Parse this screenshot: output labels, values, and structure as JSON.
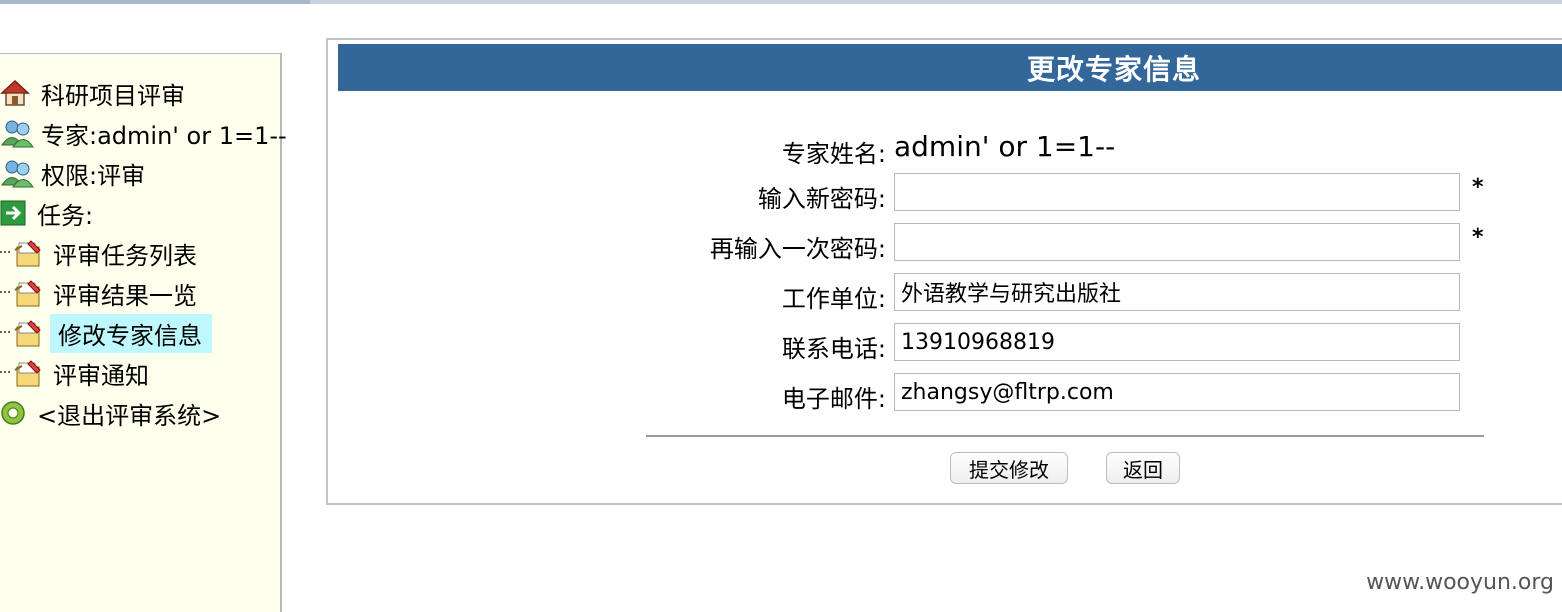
{
  "sidebar": {
    "items": [
      {
        "label": "科研项目评审",
        "icon": "home-icon"
      },
      {
        "label": "专家:admin' or 1=1--",
        "icon": "users-icon"
      },
      {
        "label": "权限:评审",
        "icon": "users-icon"
      },
      {
        "label": "任务:",
        "icon": "arrow-right-icon"
      },
      {
        "label": "评审任务列表",
        "icon": "folder-edit-icon"
      },
      {
        "label": "评审结果一览",
        "icon": "folder-edit-icon"
      },
      {
        "label": "修改专家信息",
        "icon": "folder-edit-icon",
        "active": true
      },
      {
        "label": "评审通知",
        "icon": "folder-edit-icon"
      },
      {
        "label": "<退出评审系统>",
        "icon": "exit-circle-icon"
      }
    ]
  },
  "panel": {
    "title": "更改专家信息",
    "name_label": "专家姓名:",
    "name_value": "admin' or 1=1--",
    "new_password_label": "输入新密码:",
    "confirm_password_label": "再输入一次密码:",
    "required_mark": "*",
    "workplace_label": "工作单位:",
    "workplace_value": "外语教学与研究出版社",
    "phone_label": "联系电话:",
    "phone_value": "13910968819",
    "email_label": "电子邮件:",
    "email_value": "zhangsy@fltrp.com",
    "submit_label": "提交修改",
    "back_label": "返回"
  },
  "watermark": "www.wooyun.org",
  "colors": {
    "title_bar": "#336699",
    "sidebar_bg": "#ffffee",
    "active_item_bg": "#bff7ff"
  }
}
